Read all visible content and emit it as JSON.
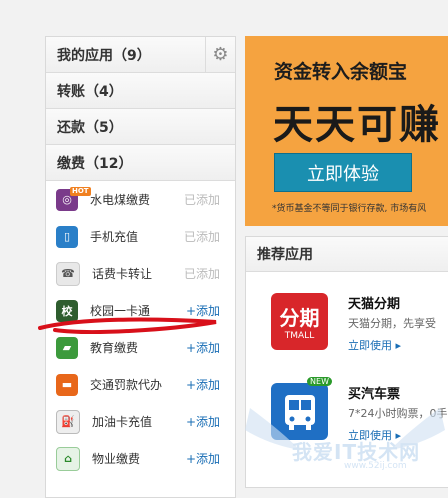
{
  "sidebar": {
    "my_apps_label": "我的应用",
    "my_apps_count": "（9）",
    "transfer_label": "转账",
    "transfer_count": "（4）",
    "repay_label": "还款",
    "repay_count": "（5）",
    "pay_label": "缴费",
    "pay_count": "（12）",
    "items": [
      {
        "name": "水电煤缴费",
        "action": "已添加",
        "badge": "HOT"
      },
      {
        "name": "手机充值",
        "action": "已添加"
      },
      {
        "name": "话费卡转让",
        "action": "已添加"
      },
      {
        "name": "校园一卡通",
        "action": "+添加"
      },
      {
        "name": "教育缴费",
        "action": "+添加"
      },
      {
        "name": "交通罚款代办",
        "action": "+添加"
      },
      {
        "name": "加油卡充值",
        "action": "+添加"
      },
      {
        "name": "物业缴费",
        "action": "+添加"
      }
    ]
  },
  "banner": {
    "line1": "资金转入余额宝",
    "line2": "天天可赚",
    "button": "立即体验",
    "note": "*货币基金不等同于银行存款, 市场有风"
  },
  "recommend": {
    "title": "推荐应用",
    "apps": [
      {
        "icon_text": "分期",
        "icon_sub": "TMALL",
        "title": "天猫分期",
        "desc": "天猫分期，先享受",
        "link": "立即使用 ▸"
      },
      {
        "icon_sub": "NEW",
        "title": "买汽车票",
        "desc": "7*24小时购票，0手",
        "link": "立即使用 ▸"
      }
    ]
  },
  "watermark": {
    "text": "我爱IT技术网",
    "url": "www.52ij.com"
  },
  "colors": {
    "accent": "#1a6eb5",
    "banner": "#f5a340",
    "button": "#1a8fb0",
    "annotation": "#d8101a"
  }
}
